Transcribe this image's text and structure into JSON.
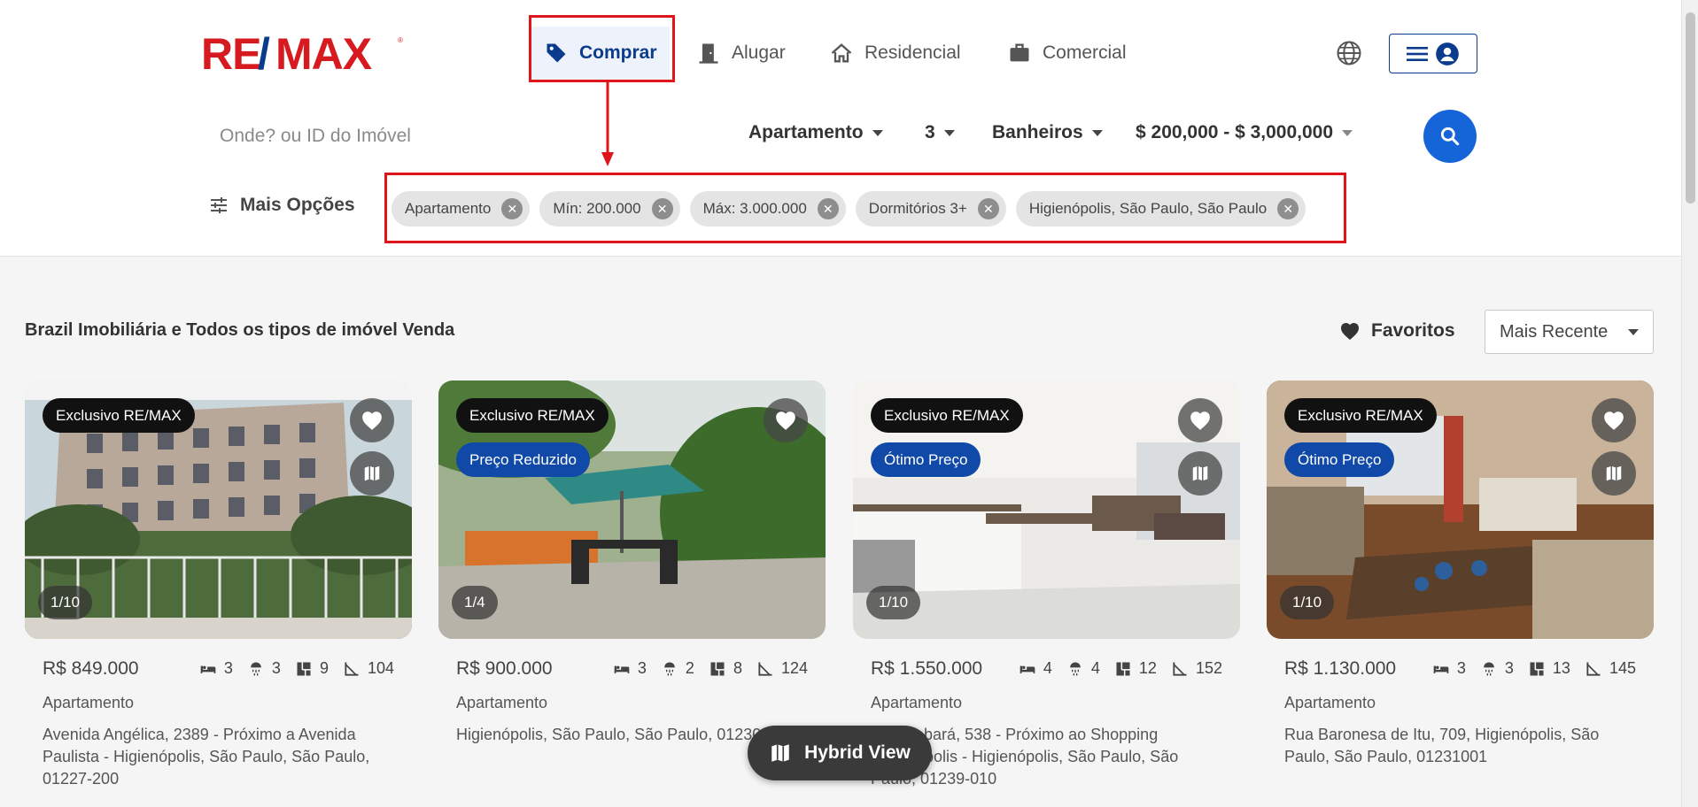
{
  "header": {
    "logo_text": "RE/MAX",
    "nav": [
      {
        "label": "Comprar",
        "icon": "tag-icon",
        "active": true
      },
      {
        "label": "Alugar",
        "icon": "door-icon"
      },
      {
        "label": "Residencial",
        "icon": "house-icon"
      },
      {
        "label": "Comercial",
        "icon": "briefcase-icon"
      }
    ]
  },
  "search": {
    "placeholder": "Onde? ou ID do Imóvel",
    "property_type": "Apartamento",
    "bedrooms": "3",
    "bathrooms": "Banheiros",
    "price_range": "$ 200,000 - $ 3,000,000"
  },
  "filters": {
    "more_options_label": "Mais Opções",
    "chips": [
      "Apartamento",
      "Mín: 200.000",
      "Máx: 3.000.000",
      "Dormitórios 3+",
      "Higienópolis, São Paulo, São Paulo"
    ]
  },
  "results": {
    "title": "Brazil Imobiliária e Todos os tipos de imóvel Venda",
    "favorites_label": "Favoritos",
    "sort_value": "Mais Recente"
  },
  "listings": [
    {
      "badge": "Exclusivo RE/MAX",
      "badge2": "",
      "counter": "1/10",
      "price": "R$ 849.000",
      "beds": "3",
      "baths": "3",
      "rooms": "9",
      "area": "104",
      "type": "Apartamento",
      "address": "Avenida Angélica, 2389 - Próximo a Avenida Paulista - Higienópolis, São Paulo, São Paulo, 01227-200"
    },
    {
      "badge": "Exclusivo RE/MAX",
      "badge2": "Preço Reduzido",
      "counter": "1/4",
      "price": "R$ 900.000",
      "beds": "3",
      "baths": "2",
      "rooms": "8",
      "area": "124",
      "type": "Apartamento",
      "address": "Higienópolis, São Paulo, São Paulo, 01230001"
    },
    {
      "badge": "Exclusivo RE/MAX",
      "badge2": "Ótimo Preço",
      "counter": "1/10",
      "price": "R$ 1.550.000",
      "beds": "4",
      "baths": "4",
      "rooms": "12",
      "area": "152",
      "type": "Apartamento",
      "address": "Rua Sabará, 538 - Próximo ao Shopping Higienópolis - Higienópolis, São Paulo, São Paulo, 01239-010"
    },
    {
      "badge": "Exclusivo RE/MAX",
      "badge2": "Ótimo Preço",
      "counter": "1/10",
      "price": "R$ 1.130.000",
      "beds": "3",
      "baths": "3",
      "rooms": "13",
      "area": "145",
      "type": "Apartamento",
      "address": "Rua Baronesa de Itu, 709, Higienópolis, São Paulo, São Paulo, 01231001"
    }
  ],
  "hybrid_view_label": "Hybrid View",
  "colors": {
    "brand_red": "#e0141b",
    "brand_blue": "#0b3b8c",
    "search_button": "#1565d8",
    "highlight_box": "#e0141b"
  }
}
